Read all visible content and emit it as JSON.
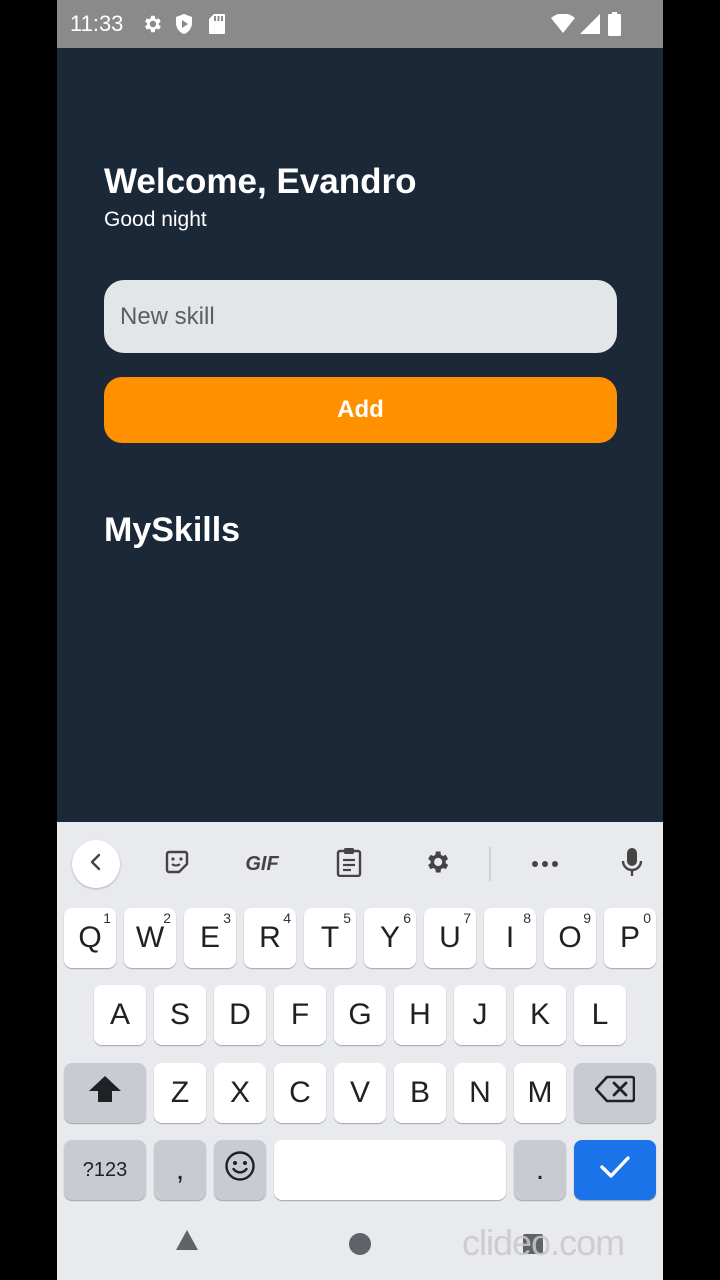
{
  "status_bar": {
    "time": "11:33"
  },
  "header": {
    "title": "Welcome, Evandro",
    "greeting": "Good night"
  },
  "form": {
    "input_placeholder": "New skill",
    "add_label": "Add"
  },
  "skills": {
    "section_title": "MySkills",
    "items": []
  },
  "keyboard": {
    "toolbar": {
      "gif_label": "GIF"
    },
    "row1": [
      {
        "key": "Q",
        "hint": "1"
      },
      {
        "key": "W",
        "hint": "2"
      },
      {
        "key": "E",
        "hint": "3"
      },
      {
        "key": "R",
        "hint": "4"
      },
      {
        "key": "T",
        "hint": "5"
      },
      {
        "key": "Y",
        "hint": "6"
      },
      {
        "key": "U",
        "hint": "7"
      },
      {
        "key": "I",
        "hint": "8"
      },
      {
        "key": "O",
        "hint": "9"
      },
      {
        "key": "P",
        "hint": "0"
      }
    ],
    "row2": [
      "A",
      "S",
      "D",
      "F",
      "G",
      "H",
      "J",
      "K",
      "L"
    ],
    "row3": [
      "Z",
      "X",
      "C",
      "V",
      "B",
      "N",
      "M"
    ],
    "symbols_label": "?123",
    "comma_label": ",",
    "period_label": "."
  },
  "watermark": "clideo.com",
  "colors": {
    "background": "#1b2838",
    "accent": "#ff9000",
    "input_bg": "#e3e6e8",
    "enter_key": "#1a73e8"
  }
}
